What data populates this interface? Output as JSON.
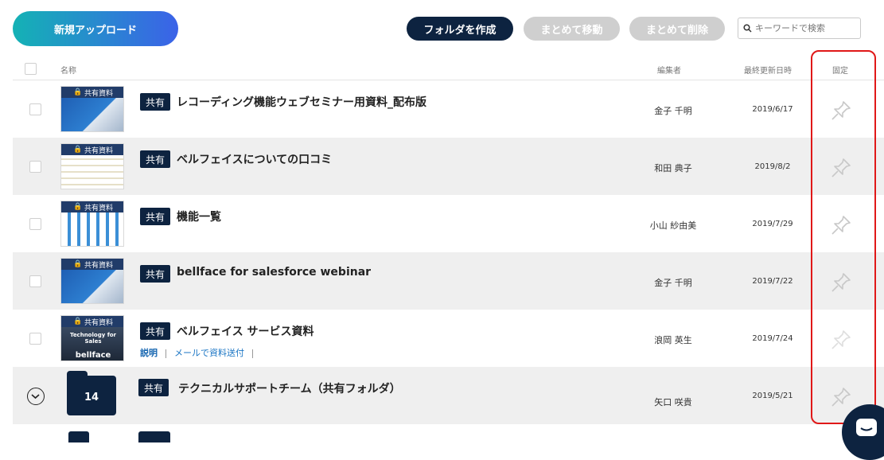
{
  "toolbar": {
    "upload_label": "新規アップロード",
    "create_folder_label": "フォルダを作成",
    "bulk_move_label": "まとめて移動",
    "bulk_delete_label": "まとめて削除",
    "search_placeholder": "キーワードで検索"
  },
  "table": {
    "headers": {
      "name": "名称",
      "editor": "編集者",
      "updated": "最終更新日時",
      "pinned": "固定"
    },
    "rows": [
      {
        "thumb_label": "共有資料",
        "badge": "共有",
        "title": "レコーディング機能ウェブセミナー用資料_配布版",
        "editor": "金子 千明",
        "date": "2019/6/17"
      },
      {
        "thumb_label": "共有資料",
        "badge": "共有",
        "title": "ベルフェイスについての口コミ",
        "editor": "和田 典子",
        "date": "2019/8/2"
      },
      {
        "thumb_label": "共有資料",
        "badge": "共有",
        "title": "機能一覧",
        "editor": "小山 紗由美",
        "date": "2019/7/29"
      },
      {
        "thumb_label": "共有資料",
        "badge": "共有",
        "title": "bellface for salesforce webinar",
        "editor": "金子 千明",
        "date": "2019/7/22"
      },
      {
        "thumb_label": "共有資料",
        "thumb_text": "Technology for Sales",
        "thumb_logo": "bellface",
        "badge": "共有",
        "title": "ベルフェイス サービス資料",
        "editor": "浪岡 英生",
        "date": "2019/7/24",
        "link_desc": "説明",
        "link_mail": "メールで資料送付"
      },
      {
        "folder_count": "14",
        "badge": "共有",
        "title": "テクニカルサポートチーム（共有フォルダ）",
        "editor": "矢口 咲貴",
        "date": "2019/5/21"
      }
    ]
  },
  "colors": {
    "navy": "#0d2340",
    "highlight": "#e01818",
    "gradient_start": "#14b2b5",
    "gradient_end": "#3b62e8"
  }
}
